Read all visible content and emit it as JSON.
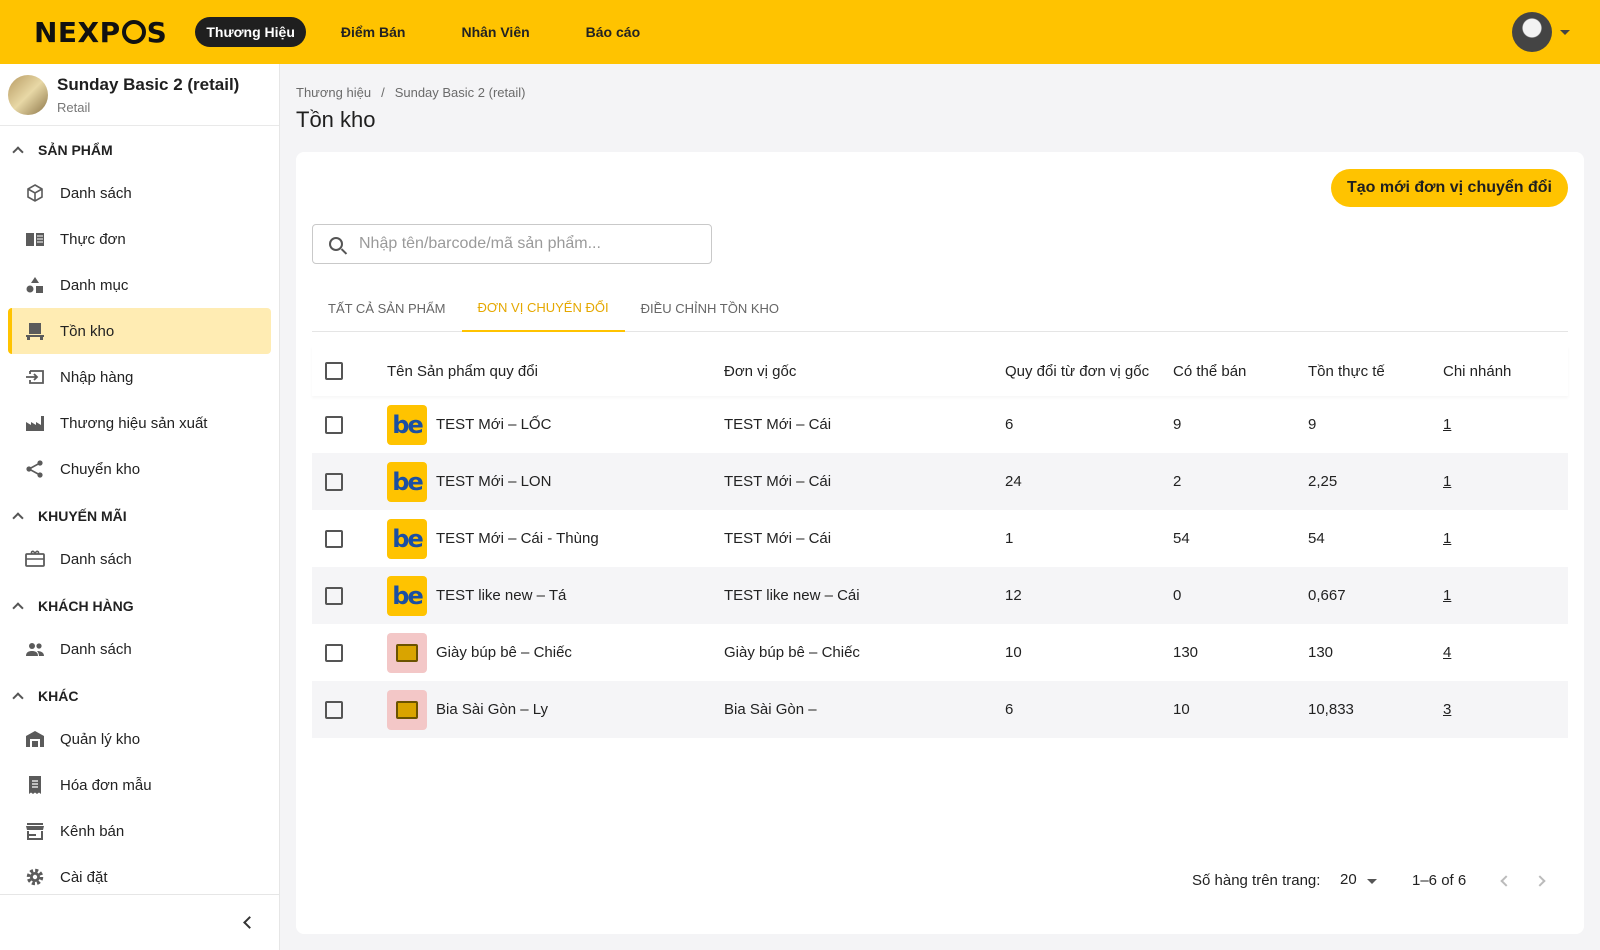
{
  "topbar": {
    "logo": "NEXPOS",
    "nav": [
      {
        "label": "Thương Hiệu",
        "active": true
      },
      {
        "label": "Điểm Bán",
        "active": false
      },
      {
        "label": "Nhân Viên",
        "active": false
      },
      {
        "label": "Báo cáo",
        "active": false
      }
    ]
  },
  "sidebar": {
    "brand": {
      "name": "Sunday Basic 2 (retail)",
      "type": "Retail"
    },
    "sections": {
      "products": "SẢN PHẨM",
      "promotions": "KHUYẾN MÃI",
      "customers": "KHÁCH HÀNG",
      "other": "KHÁC"
    },
    "items": {
      "product_list": "Danh sách",
      "menu": "Thực đơn",
      "category": "Danh mục",
      "inventory": "Tồn kho",
      "import": "Nhập hàng",
      "manufacturer": "Thương hiệu sản xuất",
      "transfer": "Chuyển kho",
      "promo_list": "Danh sách",
      "customer_list": "Danh sách",
      "warehouse": "Quản lý kho",
      "invoice_template": "Hóa đơn mẫu",
      "channel": "Kênh bán",
      "settings": "Cài đặt"
    },
    "icons": {
      "product_list": "box-icon",
      "menu": "book-icon",
      "category": "shapes-icon",
      "inventory": "pallet-icon",
      "import": "input-icon",
      "manufacturer": "factory-icon",
      "transfer": "share-icon",
      "promo_list": "gift-card-icon",
      "customer_list": "people-icon",
      "warehouse": "warehouse-icon",
      "invoice_template": "receipt-icon",
      "channel": "store-icon",
      "settings": "gear-icon"
    }
  },
  "breadcrumb": [
    "Thương hiệu",
    "/",
    "Sunday Basic 2 (retail)"
  ],
  "page_title": "Tồn kho",
  "main": {
    "create_button": "Tạo mới đơn vị chuyển đổi",
    "search_placeholder": "Nhập tên/barcode/mã sản phẩm...",
    "tabs": [
      {
        "label": "Tất cả sản phẩm",
        "active": false
      },
      {
        "label": "Đơn vị chuyển đổi",
        "active": true
      },
      {
        "label": "Điều chỉnh tồn kho",
        "active": false
      }
    ],
    "columns": [
      "Tên Sản phẩm quy đổi",
      "Đơn vị gốc",
      "Quy đổi từ đơn vị gốc",
      "Có thể bán",
      "Tồn thực tế",
      "Chi nhánh"
    ],
    "rows": [
      {
        "thumb": "be",
        "name": "TEST Mới – LỐC",
        "unit": "TEST Mới – Cái",
        "rate": "6",
        "sellable": "9",
        "actual": "9",
        "branch": "1"
      },
      {
        "thumb": "be",
        "name": "TEST Mới – LON",
        "unit": "TEST Mới – Cái",
        "rate": "24",
        "sellable": "2",
        "actual": "2,25",
        "branch": "1"
      },
      {
        "thumb": "be",
        "name": "TEST Mới – Cái - Thùng",
        "unit": "TEST Mới – Cái",
        "rate": "1",
        "sellable": "54",
        "actual": "54",
        "branch": "1"
      },
      {
        "thumb": "be",
        "name": "TEST like new – Tá",
        "unit": "TEST like new – Cái",
        "rate": "12",
        "sellable": "0",
        "actual": "0,667",
        "branch": "1"
      },
      {
        "thumb": "box",
        "name": "Giày búp bê – Chiếc",
        "unit": "Giày búp bê – Chiếc",
        "rate": "10",
        "sellable": "130",
        "actual": "130",
        "branch": "4"
      },
      {
        "thumb": "box",
        "name": "Bia Sài Gòn – Ly",
        "unit": "Bia Sài Gòn –",
        "rate": "6",
        "sellable": "10",
        "actual": "10,833",
        "branch": "3"
      }
    ],
    "thumb_logo_text": "be",
    "pagination": {
      "rows_per_page_label": "Số hàng trên trang:",
      "rows_per_page": "20",
      "range": "1–6 of 6"
    }
  },
  "colors": {
    "accent": "#ffc300",
    "dark": "#1f1f1f",
    "tab_active": "#e5a800"
  }
}
